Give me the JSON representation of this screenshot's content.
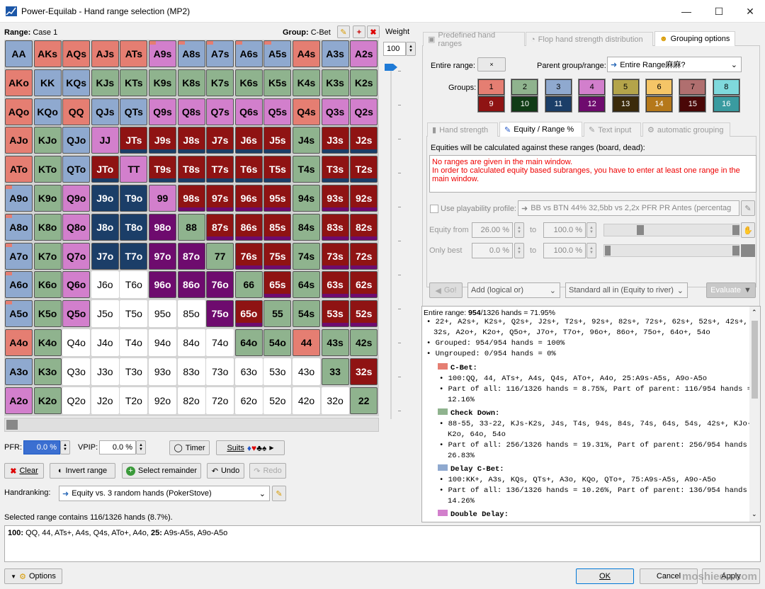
{
  "window": {
    "title": "Power-Equilab - Hand range selection (MP2)"
  },
  "header": {
    "range_label": "Range:",
    "range_value": "Case 1",
    "group_label": "Group:",
    "group_value": "C-Bet",
    "weight_label": "Weight",
    "weight_value": "100"
  },
  "colors": {
    "red": "#e57e72",
    "green": "#8fb38e",
    "blue": "#8fa9cf",
    "pink": "#d27fcc",
    "maroon": "#8f1313",
    "darkblue": "#1b3e68",
    "purple": "#6e0b6e",
    "dark_green": "#3e6b2a"
  },
  "grid": [
    [
      "AA",
      "AKs",
      "AQs",
      "AJs",
      "ATs",
      "A9s",
      "A8s",
      "A7s",
      "A6s",
      "A5s",
      "A4s",
      "A3s",
      "A2s"
    ],
    [
      "AKo",
      "KK",
      "KQs",
      "KJs",
      "KTs",
      "K9s",
      "K8s",
      "K7s",
      "K6s",
      "K5s",
      "K4s",
      "K3s",
      "K2s"
    ],
    [
      "AQo",
      "KQo",
      "QQ",
      "QJs",
      "QTs",
      "Q9s",
      "Q8s",
      "Q7s",
      "Q6s",
      "Q5s",
      "Q4s",
      "Q3s",
      "Q2s"
    ],
    [
      "AJo",
      "KJo",
      "QJo",
      "JJ",
      "JTs",
      "J9s",
      "J8s",
      "J7s",
      "J6s",
      "J5s",
      "J4s",
      "J3s",
      "J2s"
    ],
    [
      "ATo",
      "KTo",
      "QTo",
      "JTo",
      "TT",
      "T9s",
      "T8s",
      "T7s",
      "T6s",
      "T5s",
      "T4s",
      "T3s",
      "T2s"
    ],
    [
      "A9o",
      "K9o",
      "Q9o",
      "J9o",
      "T9o",
      "99",
      "98s",
      "97s",
      "96s",
      "95s",
      "94s",
      "93s",
      "92s"
    ],
    [
      "A8o",
      "K8o",
      "Q8o",
      "J8o",
      "T8o",
      "98o",
      "88",
      "87s",
      "86s",
      "85s",
      "84s",
      "83s",
      "82s"
    ],
    [
      "A7o",
      "K7o",
      "Q7o",
      "J7o",
      "T7o",
      "97o",
      "87o",
      "77",
      "76s",
      "75s",
      "74s",
      "73s",
      "72s"
    ],
    [
      "A6o",
      "K6o",
      "Q6o",
      "J6o",
      "T6o",
      "96o",
      "86o",
      "76o",
      "66",
      "65s",
      "64s",
      "63s",
      "62s"
    ],
    [
      "A5o",
      "K5o",
      "Q5o",
      "J5o",
      "T5o",
      "95o",
      "85o",
      "75o",
      "65o",
      "55",
      "54s",
      "53s",
      "52s"
    ],
    [
      "A4o",
      "K4o",
      "Q4o",
      "J4o",
      "T4o",
      "94o",
      "84o",
      "74o",
      "64o",
      "54o",
      "44",
      "43s",
      "42s"
    ],
    [
      "A3o",
      "K3o",
      "Q3o",
      "J3o",
      "T3o",
      "93o",
      "83o",
      "73o",
      "63o",
      "53o",
      "43o",
      "33",
      "32s"
    ],
    [
      "A2o",
      "K2o",
      "Q2o",
      "J2o",
      "T2o",
      "92o",
      "82o",
      "72o",
      "62o",
      "52o",
      "42o",
      "32o",
      "22"
    ]
  ],
  "grid_colors": [
    [
      "blue",
      "red",
      "red",
      "red",
      "red",
      "pink",
      "blue",
      "blue",
      "blue",
      "blue",
      "red",
      "blue",
      "pink"
    ],
    [
      "red",
      "blue",
      "blue",
      "green",
      "green",
      "green",
      "green",
      "green",
      "green",
      "green",
      "green",
      "green",
      "green"
    ],
    [
      "red",
      "blue",
      "red",
      "blue",
      "blue",
      "pink",
      "pink",
      "pink",
      "pink",
      "pink",
      "red",
      "pink",
      "pink"
    ],
    [
      "red",
      "green",
      "blue",
      "pink",
      "maroon",
      "maroon",
      "maroon",
      "maroon",
      "maroon",
      "maroon",
      "green",
      "maroon",
      "maroon"
    ],
    [
      "red",
      "green",
      "blue",
      "maroon",
      "pink",
      "maroon",
      "maroon",
      "maroon",
      "maroon",
      "maroon",
      "green",
      "maroon",
      "maroon"
    ],
    [
      "blue",
      "green",
      "pink",
      "darkblue",
      "darkblue",
      "pink",
      "maroon",
      "maroon",
      "maroon",
      "maroon",
      "green",
      "maroon",
      "maroon"
    ],
    [
      "blue",
      "green",
      "pink",
      "darkblue",
      "darkblue",
      "purple",
      "green",
      "maroon",
      "maroon",
      "maroon",
      "green",
      "maroon",
      "maroon"
    ],
    [
      "blue",
      "green",
      "pink",
      "darkblue",
      "darkblue",
      "purple",
      "purple",
      "green",
      "maroon",
      "maroon",
      "green",
      "maroon",
      "maroon"
    ],
    [
      "blue",
      "green",
      "pink",
      "w",
      "w",
      "purple",
      "purple",
      "purple",
      "green",
      "maroon",
      "green",
      "maroon",
      "maroon"
    ],
    [
      "blue",
      "green",
      "pink",
      "w",
      "w",
      "w",
      "w",
      "purple",
      "maroon",
      "green",
      "green",
      "maroon",
      "maroon"
    ],
    [
      "red",
      "green",
      "w",
      "w",
      "w",
      "w",
      "w",
      "w",
      "green",
      "green",
      "red",
      "green",
      "green"
    ],
    [
      "blue",
      "green",
      "w",
      "w",
      "w",
      "w",
      "w",
      "w",
      "w",
      "w",
      "w",
      "green",
      "maroon"
    ],
    [
      "pink",
      "green",
      "w",
      "w",
      "w",
      "w",
      "w",
      "w",
      "w",
      "w",
      "w",
      "w",
      "green"
    ]
  ],
  "left_controls": {
    "pfr_label": "PFR:",
    "pfr_value": "0.0 %",
    "vpip_label": "VPIP:",
    "vpip_value": "0.0 %",
    "timer": "Timer",
    "suits": "Suits",
    "clear": "Clear",
    "invert": "Invert range",
    "select_remainder": "Select remainder",
    "undo": "Undo",
    "redo": "Redo",
    "handranking_label": "Handranking:",
    "handranking_value": "Equity vs. 3 random hands (PokerStove)",
    "selected_info": "Selected range contains 116/1326 hands (8.7%).",
    "range_text_b1": "100:",
    "range_text_1": " QQ, 44, ATs+, A4s, Q4s, ATo+, A4o, ",
    "range_text_b2": "25:",
    "range_text_2": " A9s-A5s, A9o-A5o"
  },
  "tabs_top": [
    "Predefined hand ranges",
    "Flop hand strength distribution",
    "Grouping options"
  ],
  "grouping": {
    "entire_range_label": "Entire range:",
    "entire_btn": "×",
    "parent_label": "Parent group/range:",
    "parent_value": "Entire Range麻麻?",
    "groups_label": "Groups:",
    "groups": [
      "1",
      "2",
      "3",
      "4",
      "5",
      "6",
      "7",
      "8",
      "9",
      "10",
      "11",
      "12",
      "13",
      "14",
      "15",
      "16"
    ],
    "group_colors": [
      "#e57e72",
      "#8fb38e",
      "#8fa9cf",
      "#d27fcc",
      "#b4a44a",
      "#f5c567",
      "#b06f6f",
      "#7fd9dc",
      "#8f1313",
      "#103c16",
      "#1b3e68",
      "#6e0b6e",
      "#3b2a0a",
      "#b5781a",
      "#4a0707",
      "#3a9ba0"
    ]
  },
  "tabs_sub": [
    "Hand strength",
    "Equity / Range %",
    "Text input",
    "automatic grouping"
  ],
  "equity": {
    "intro": "Equities will be calculated against these ranges (board, dead):",
    "error1": "No ranges are given in the main window.",
    "error2": "In order to calculated equity based subranges, you have to enter at least one range in the main window.",
    "use_profile": "Use playability profile:",
    "profile_value": "BB vs BTN 44% 32,5bb vs 2,2x PFR PR Antes  (percentag",
    "eq_from_label": "Equity from",
    "eq_from": "26.00 %",
    "to1": "to",
    "eq_to": "100.0 %",
    "only_best_label": "Only best",
    "best_from": "0.0 %",
    "to2": "to",
    "best_to": "100.0 %",
    "go": "Go!",
    "add_mode": "Add (logical or)",
    "allin_mode": "Standard all in (Equity to river)",
    "evaluate": "Evaluate"
  },
  "summary": {
    "line1_a": "Entire range: ",
    "line1_b": "954",
    "line1_c": "/1326 hands = 71.95%",
    "bullets1": [
      "22+, A2s+, K2s+, Q2s+, J2s+, T2s+, 92s+, 82s+, 72s+, 62s+, 52s+, 42s+,",
      "32s, A2o+, K2o+, Q5o+, J7o+, T7o+, 96o+, 86o+, 75o+, 64o+, 54o"
    ],
    "grouped": "Grouped: 954/954 hands = 100%",
    "ungrouped": "Ungrouped: 0/954 hands = 0%",
    "g1_title": "C-Bet:",
    "g1_hands": "100:QQ, 44, ATs+, A4s, Q4s, ATo+, A4o, 25:A9s-A5s, A9o-A5o",
    "g1_part1": "Part of all: 116/1326 hands = 8.75%, Part of parent: 116/954 hands =",
    "g1_part2": "12.16%",
    "g2_title": "Check Down:",
    "g2_hands1": "88-55, 33-22, KJs-K2s, J4s, T4s, 94s, 84s, 74s, 64s, 54s, 42s+, KJo-",
    "g2_hands2": "K2o, 64o, 54o",
    "g2_part1": "Part of all: 256/1326 hands = 19.31%, Part of parent: 256/954 hands =",
    "g2_part2": "26.83%",
    "g3_title": "Delay C-Bet:",
    "g3_hands": "100:KK+, A3s, KQs, QTs+, A3o, KQo, QTo+, 75:A9s-A5s, A9o-A5o",
    "g3_part1": "Part of all: 136/1326 hands = 10.26%, Part of parent: 136/954 hands =",
    "g3_part2": "14.26%",
    "g4_title": "Double Delay:"
  },
  "footer": {
    "options": "Options",
    "ok": "OK",
    "cancel": "Cancel",
    "apply": "Apply",
    "watermark": "moshiedu.com"
  }
}
